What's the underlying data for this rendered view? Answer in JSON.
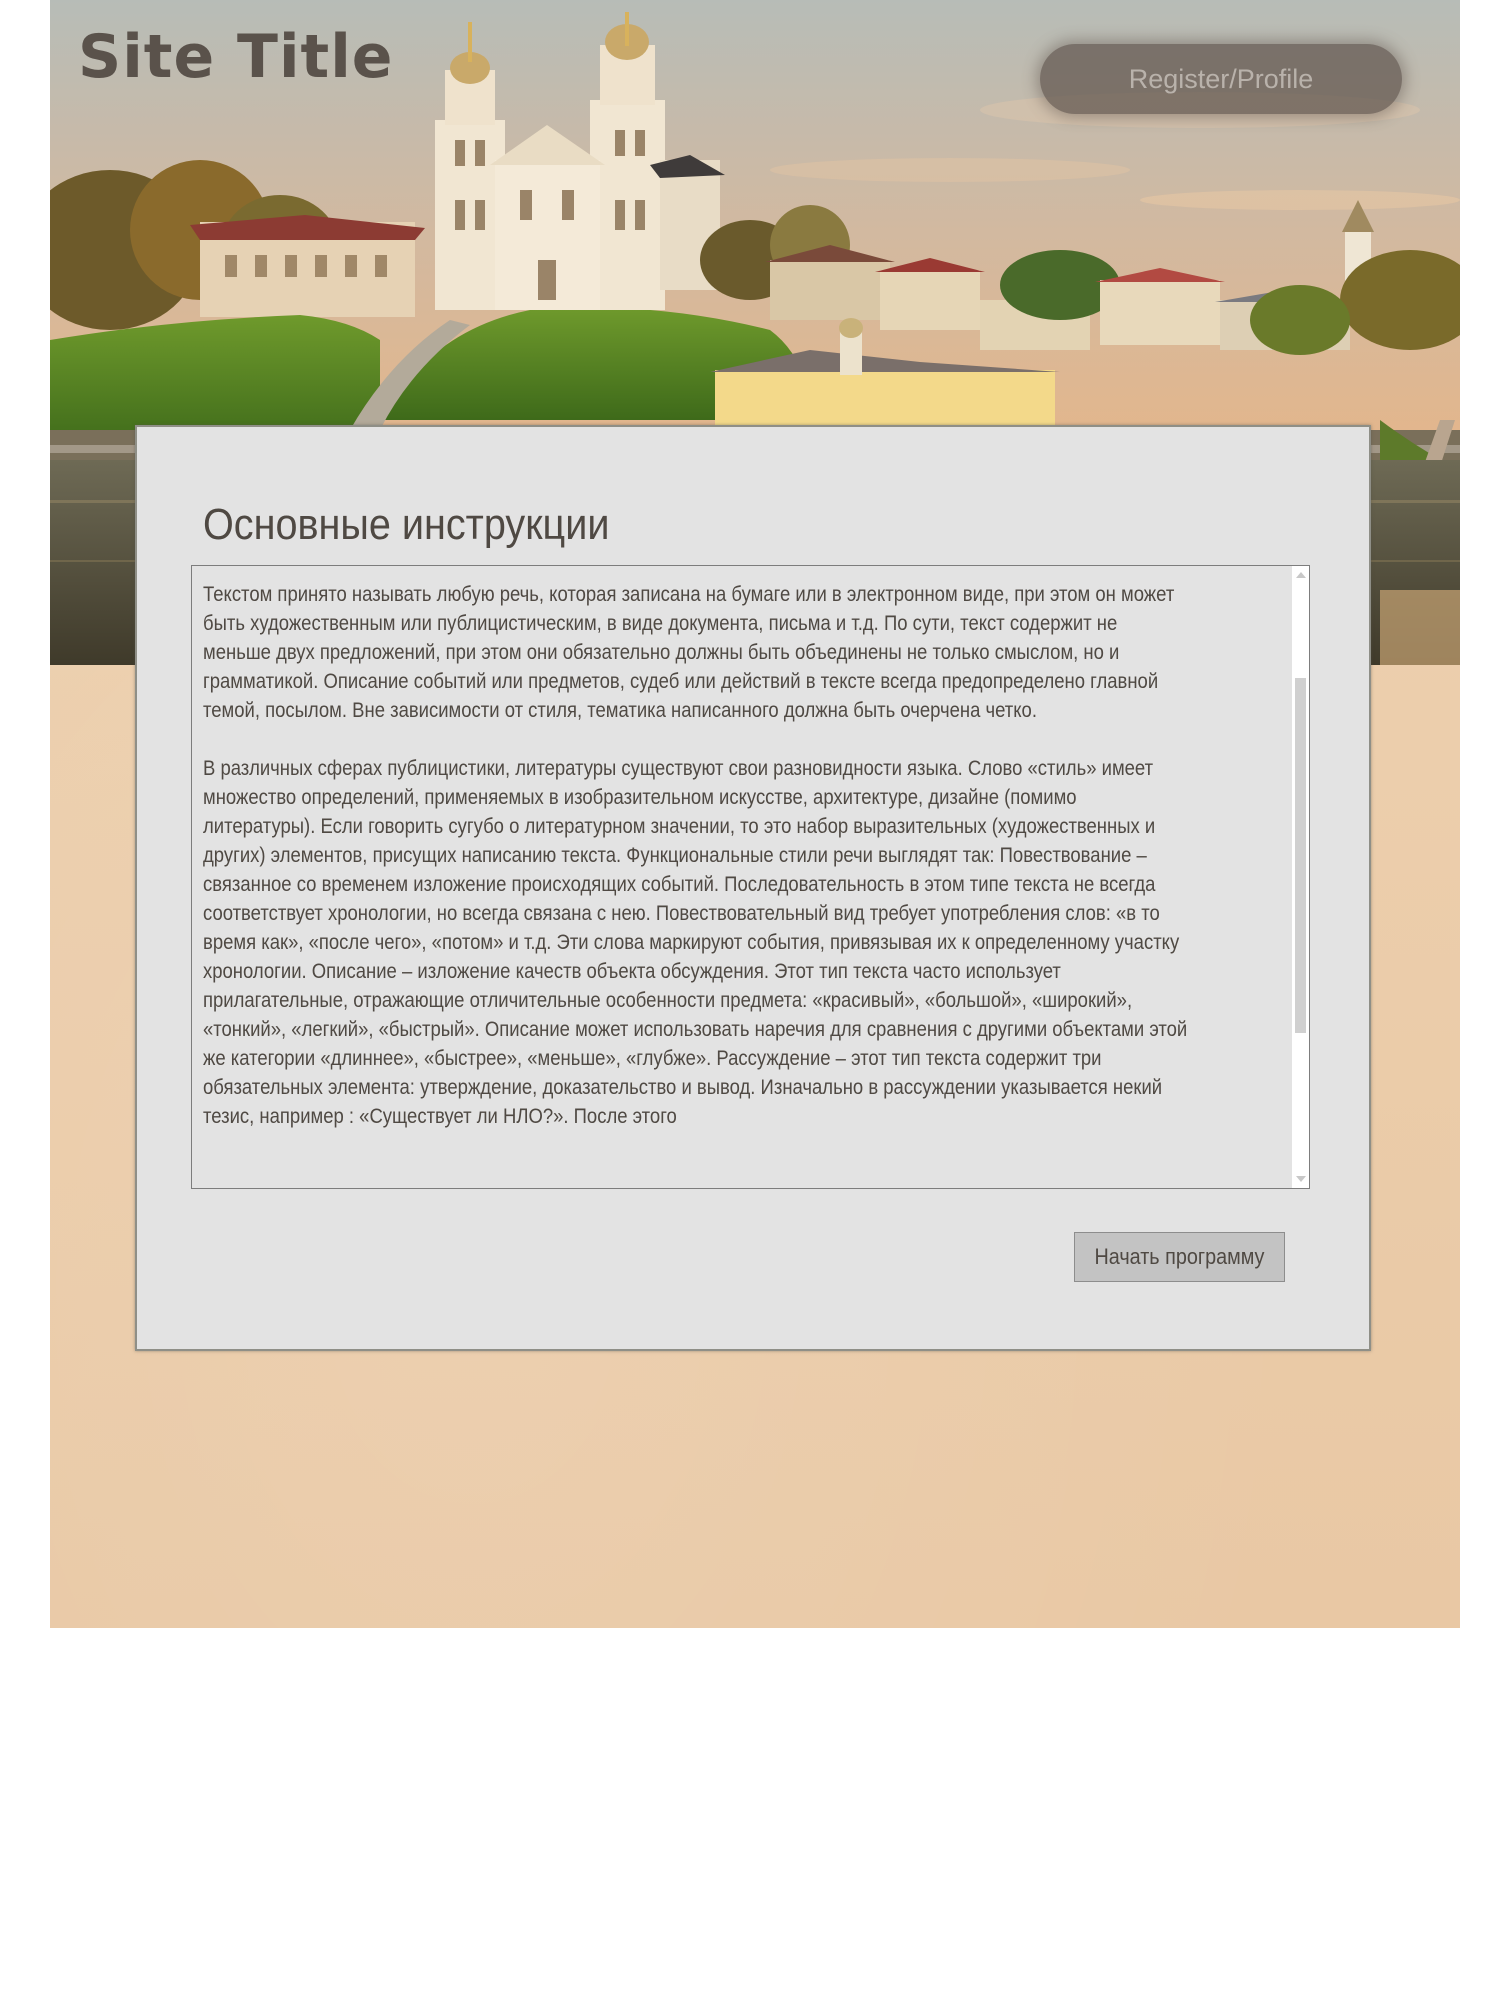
{
  "header": {
    "site_title": "Site Title",
    "register_label": "Register/Profile"
  },
  "hero": {
    "image_subject": "riverside town with white baroque church on a green hill at sunset"
  },
  "panel": {
    "title": "Основные инструкции",
    "paragraphs": [
      "Текстом принято называть любую речь, которая записана на бумаге или в электронном виде, при этом он может быть художественным или публицистическим, в виде документа, письма и т.д. По сути, текст содержит не меньше двух предложений, при этом они обязательно должны быть объединены не только смыслом, но и грамматикой. Описание событий или предметов, судеб или действий в тексте всегда предопределено главной темой, посылом. Вне зависимости от стиля, тематика написанного должна быть очерчена четко.",
      "В различных сферах публицистики, литературы существуют свои разновидности языка. Слово «стиль» имеет множество определений, применяемых в изобразительном искусстве, архитектуре, дизайне (помимо литературы). Если говорить сугубо о литературном значении, то это набор выразительных (художественных и других) элементов, присущих написанию текста. Функциональные стили речи выглядят так: Повествование – связанное со временем изложение происходящих событий. Последовательность в этом типе текста не всегда соответствует хронологии, но всегда связана с нею. Повествовательный вид требует употребления слов: «в то время как», «после чего», «потом» и т.д. Эти слова маркируют события, привязывая их к определенному участку хронологии. Описание – изложение качеств объекта обсуждения. Этот тип текста часто использует прилагательные, отражающие отличительные особенности предмета: «красивый», «большой», «широкий», «тонкий», «легкий», «быстрый». Описание может использовать наречия для сравнения с другими объектами этой же категории «длиннее», «быстрее», «меньше», «глубже». Рассуждение – этот тип текста содержит три обязательных элемента: утверждение, доказательство и вывод. Изначально в рассуждении указывается некий тезис, например : «Существует ли НЛО?». После этого"
    ],
    "start_button_label": "Начать программу"
  },
  "colors": {
    "text": "#4f4943",
    "panel_background": "#e3e3e3",
    "page_background": "#ecceac",
    "register_button": "#5f554e"
  }
}
